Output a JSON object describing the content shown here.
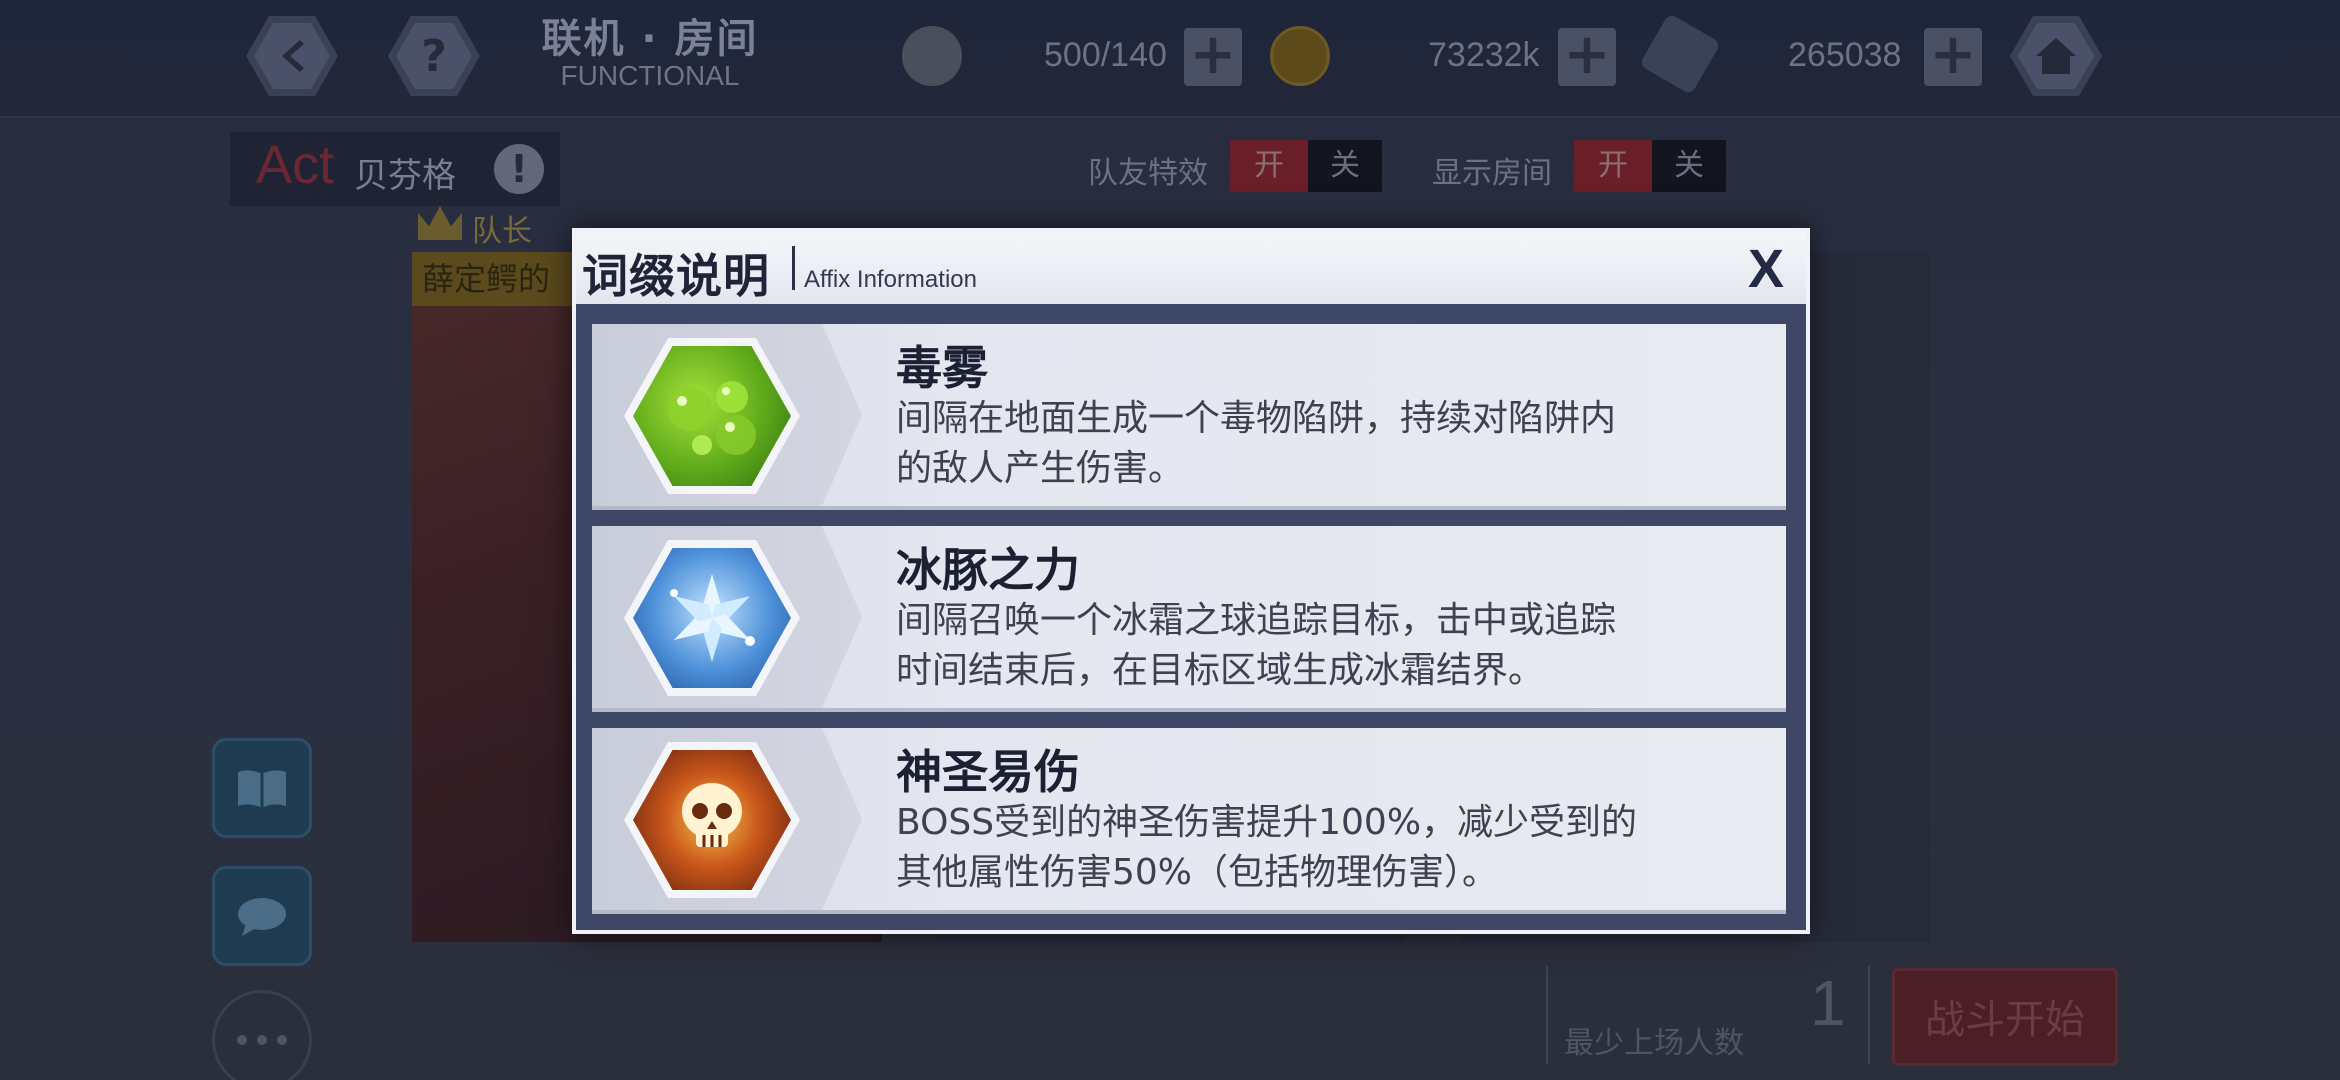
{
  "topbar": {
    "room_title": "联机 · 房间",
    "room_subtitle": "FUNCTIONAL",
    "stamina": "500/140",
    "coins": "73232k",
    "crystals": "265038"
  },
  "room": {
    "act_label": "Act",
    "boss_name": "贝芬格",
    "leader_label": "队长",
    "member_name": "薛定鳄的",
    "teammate_effects_label": "队友特效",
    "show_room_label": "显示房间",
    "toggle_on": "开",
    "toggle_off": "关",
    "min_players_label": "最少上场人数",
    "min_players_value": "1",
    "start_battle_label": "战斗开始"
  },
  "dialog": {
    "title": "词缀说明",
    "subtitle": "Affix Information",
    "close_label": "X",
    "affixes": [
      {
        "icon": "poison-fog-icon",
        "name": "毒雾",
        "description_line1": "间隔在地面生成一个毒物陷阱，持续对陷阱内",
        "description_line2": "的敌人产生伤害。"
      },
      {
        "icon": "ice-crystal-icon",
        "name": "冰豚之力",
        "description_line1": "间隔召唤一个冰霜之球追踪目标，击中或追踪",
        "description_line2": "时间结束后，在目标区域生成冰霜结界。"
      },
      {
        "icon": "skull-icon",
        "name": "神圣易伤",
        "description_line1": "BOSS受到的神圣伤害提升100%，减少受到的",
        "description_line2": "其他属性伤害50%（包括物理伤害）。"
      }
    ]
  },
  "colors": {
    "dialog_body": "#3e4866",
    "card_bg": "#e4e7ef",
    "title_text": "#1c2033",
    "desc_text": "#3d4150"
  }
}
